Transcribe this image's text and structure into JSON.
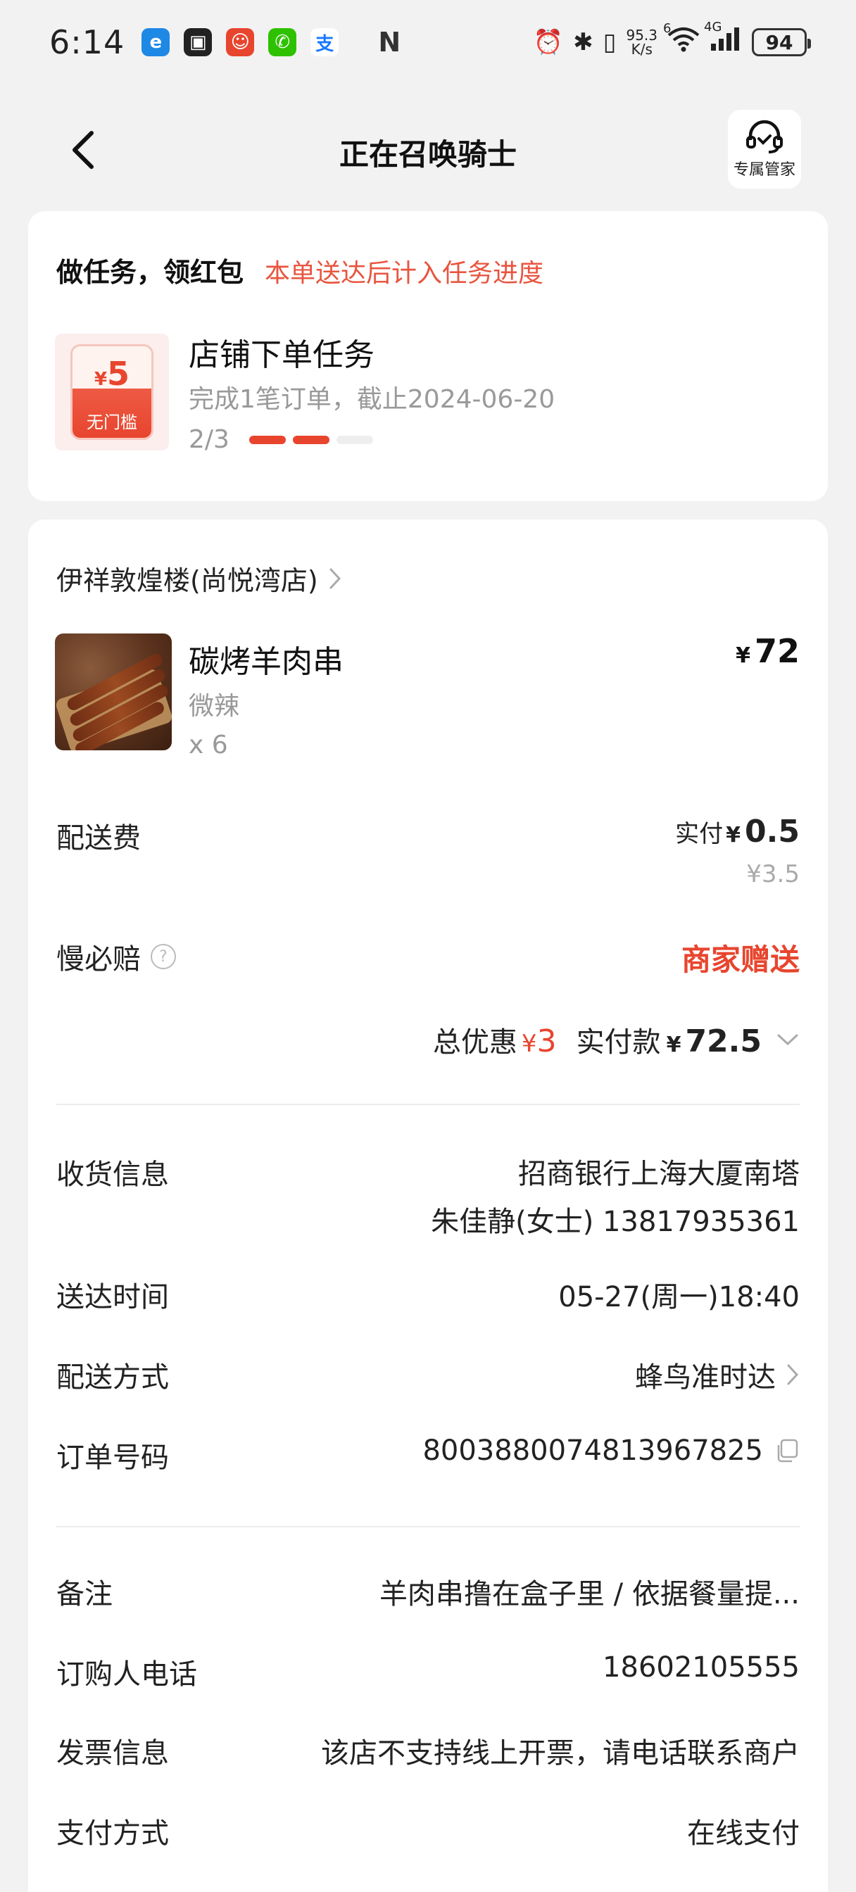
{
  "status_bar": {
    "time": "6:14",
    "network_speed_value": "95.3",
    "network_speed_unit": "K/s",
    "wifi_badge": "6",
    "cell_badge": "4G",
    "battery": "94"
  },
  "header": {
    "title": "正在召唤骑士",
    "manager_label": "专属管家"
  },
  "task": {
    "title": "做任务，领红包",
    "subtitle": "本单送达后计入任务进度",
    "coupon_currency": "¥",
    "coupon_amount": "5",
    "coupon_note": "无门槛",
    "name": "店铺下单任务",
    "desc": "完成1笔订单，截止2024-06-20",
    "progress_text": "2/3",
    "progress_done": 2,
    "progress_total": 3
  },
  "order": {
    "shop_name": "伊祥敦煌楼(尚悦湾店)",
    "item": {
      "name": "碳烤羊肉串",
      "spec": "微辣",
      "qty": "x 6",
      "currency": "¥",
      "price": "72"
    },
    "delivery_fee": {
      "label": "配送费",
      "paid_label": "实付",
      "currency": "¥",
      "paid": "0.5",
      "original": "¥3.5"
    },
    "slow_compensation": {
      "label": "慢必赔",
      "help_icon": "?",
      "value": "商家赠送"
    },
    "total": {
      "discount_label": "总优惠",
      "discount_currency": "¥",
      "discount": "3",
      "paid_label": "实付款",
      "paid_currency": "¥",
      "paid": "72.5"
    },
    "details": {
      "address_label": "收货信息",
      "address_line1": "招商银行上海大厦南塔",
      "address_line2": "朱佳静(女士) 13817935361",
      "time_label": "送达时间",
      "time_value": "05-27(周一)18:40",
      "method_label": "配送方式",
      "method_value": "蜂鸟准时达",
      "order_no_label": "订单号码",
      "order_no_value": "8003880074813967825",
      "note_label": "备注",
      "note_value": "羊肉串撸在盒子里 / 依据餐量提...",
      "phone_label": "订购人电话",
      "phone_value": "18602105555",
      "invoice_label": "发票信息",
      "invoice_value": "该店不支持线上开票，请电话联系商户",
      "payment_label": "支付方式",
      "payment_value": "在线支付"
    }
  },
  "colors": {
    "accent": "#e8452e",
    "page_bg": "#f2f2f2",
    "card_bg": "#ffffff",
    "muted_text": "#999999"
  },
  "icons": {
    "back": "chevron-left-icon",
    "manager": "headset-icon",
    "shop_link": "chevron-right-icon",
    "help": "question-circle-icon",
    "expand": "chevron-down-icon",
    "copy": "copy-icon"
  }
}
